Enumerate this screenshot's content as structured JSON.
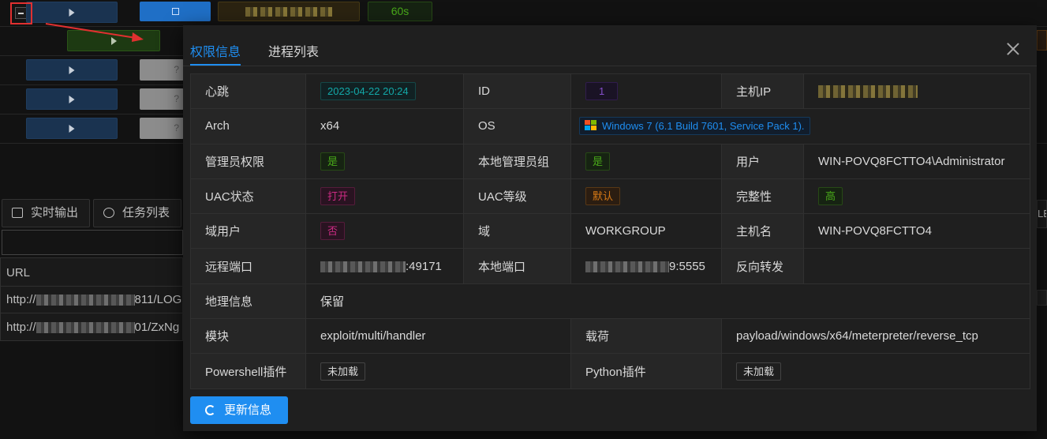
{
  "background": {
    "timer_label": "60s",
    "toolbar_tabs": [
      "实时输出",
      "任务列表"
    ],
    "url_header": "URL",
    "url_rows": [
      "http://",
      "http://"
    ],
    "url_row_suffixes": [
      "811/LOG",
      "01/ZxNg"
    ],
    "gray_button_text": "?",
    "right_partial_label": "LE",
    "expand_icon": "minus-square-icon",
    "annotation_color": "#e03030"
  },
  "modal": {
    "tabs": [
      {
        "label": "权限信息",
        "active": true
      },
      {
        "label": "进程列表",
        "active": false
      }
    ],
    "close_icon": "close-icon",
    "rows": {
      "heartbeat": {
        "label": "心跳",
        "value": "2023-04-22 20:24"
      },
      "id": {
        "label": "ID",
        "value": "1"
      },
      "host_ip": {
        "label": "主机IP"
      },
      "arch": {
        "label": "Arch",
        "value": "x64"
      },
      "os": {
        "label": "OS",
        "value": "Windows 7 (6.1 Build 7601, Service Pack 1)."
      },
      "admin": {
        "label": "管理员权限",
        "value": "是"
      },
      "local_admin_group": {
        "label": "本地管理员组",
        "value": "是"
      },
      "user": {
        "label": "用户",
        "value": "WIN-POVQ8FCTTO4\\Administrator"
      },
      "uac_status": {
        "label": "UAC状态",
        "value": "打开"
      },
      "uac_level": {
        "label": "UAC等级",
        "value": "默认"
      },
      "integrity": {
        "label": "完整性",
        "value": "高"
      },
      "domain_user": {
        "label": "域用户",
        "value": "否"
      },
      "domain": {
        "label": "域",
        "value": "WORKGROUP"
      },
      "hostname": {
        "label": "主机名",
        "value": "WIN-POVQ8FCTTO4"
      },
      "remote_port": {
        "label": "远程端口",
        "value": ":49171"
      },
      "local_port": {
        "label": "本地端口",
        "value": "9:5555"
      },
      "reverse_forward": {
        "label": "反向转发",
        "value": ""
      },
      "geo": {
        "label": "地理信息",
        "value": "保留"
      },
      "module": {
        "label": "模块",
        "value": "exploit/multi/handler"
      },
      "payload": {
        "label": "载荷",
        "value": "payload/windows/x64/meterpreter/reverse_tcp"
      },
      "powershell_plugin": {
        "label": "Powershell插件",
        "value": "未加载"
      },
      "python_plugin": {
        "label": "Python插件",
        "value": "未加载"
      }
    },
    "refresh_button": "更新信息"
  },
  "colors": {
    "accent": "#1f8ef1",
    "background": "#1f1f1f"
  }
}
